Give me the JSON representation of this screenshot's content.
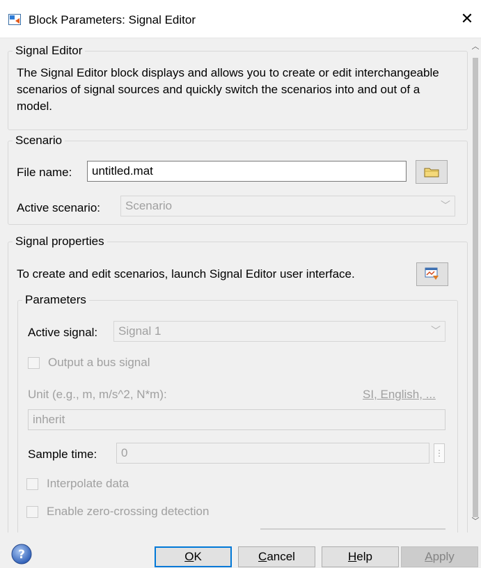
{
  "window": {
    "title": "Block Parameters: Signal Editor",
    "close_glyph": "✕"
  },
  "signal_editor_group": {
    "legend": "Signal Editor",
    "description": "The Signal Editor block displays and allows you to create or edit interchangeable scenarios of signal sources and quickly switch the scenarios into and out of a model."
  },
  "scenario_group": {
    "legend": "Scenario",
    "file_name_label": "File name:",
    "file_name_value": "untitled.mat",
    "active_scenario_label": "Active scenario:",
    "active_scenario_value": "Scenario"
  },
  "signal_properties_group": {
    "legend": "Signal properties",
    "launch_text": "To create and edit scenarios, launch Signal Editor user interface."
  },
  "parameters_group": {
    "legend": "Parameters",
    "active_signal_label": "Active signal:",
    "active_signal_value": "Signal 1",
    "output_bus_label": "Output a bus signal",
    "output_bus_checked": false,
    "unit_label": "Unit (e.g., m, m/s^2, N*m):",
    "unit_link": "SI, English, ...",
    "unit_value": "inherit",
    "sample_time_label": "Sample time:",
    "sample_time_value": "0",
    "interpolate_label": "Interpolate data",
    "interpolate_checked": false,
    "zero_crossing_label": "Enable zero-crossing detection",
    "zero_crossing_checked": false
  },
  "footer": {
    "ok": {
      "label_u": "O",
      "label_rest": "K"
    },
    "cancel": {
      "label_u": "C",
      "label_rest": "ancel"
    },
    "help": {
      "label_u": "H",
      "label_rest": "elp"
    },
    "apply": {
      "label_u": "A",
      "label_rest": "pply"
    }
  },
  "icons": {
    "app": "simulink-block-icon",
    "browse": "folder-icon",
    "launch": "signal-editor-icon",
    "help": "help-question-icon"
  },
  "colors": {
    "default_button_border": "#0078d7",
    "disabled_text": "#a0a0a0"
  }
}
